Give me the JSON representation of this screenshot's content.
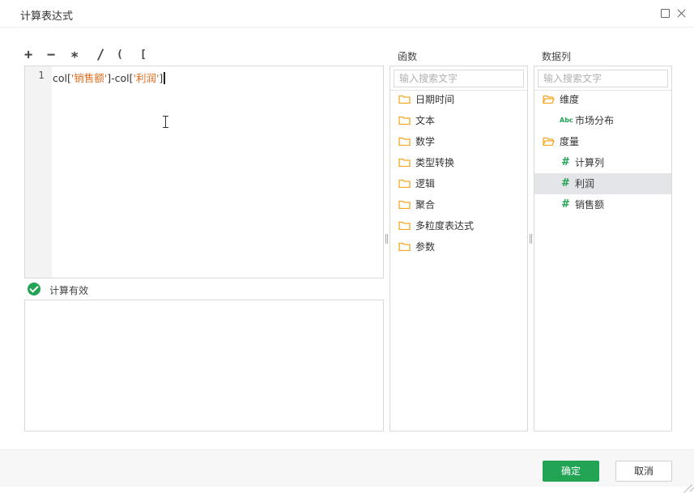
{
  "dialog": {
    "title": "计算表达式",
    "maximize_icon": "maximize-icon",
    "close_icon": "close-icon"
  },
  "operators": [
    "+",
    "−",
    "∗",
    "/",
    "( )",
    "[ ]"
  ],
  "editor": {
    "line_number": "1",
    "code_parts": [
      "col[",
      "'销售额'",
      "]-col[",
      "'利润'",
      "]"
    ]
  },
  "status": {
    "text": "计算有效",
    "icon": "check-circle-icon",
    "color": "#23a455"
  },
  "functions": {
    "header": "函数",
    "search_placeholder": "输入搜索文字",
    "items": [
      "日期时间",
      "文本",
      "数学",
      "类型转换",
      "逻辑",
      "聚合",
      "多粒度表达式",
      "参数"
    ]
  },
  "columns": {
    "header": "数据列",
    "search_placeholder": "输入搜索文字",
    "dimension": {
      "label": "维度",
      "children": [
        {
          "badge": "Abc",
          "label": "市场分布"
        }
      ]
    },
    "measure": {
      "label": "度量",
      "children": [
        {
          "badge": "#",
          "label": "计算列"
        },
        {
          "badge": "#",
          "label": "利润",
          "selected": true
        },
        {
          "badge": "#",
          "label": "销售额"
        }
      ]
    }
  },
  "footer": {
    "ok_label": "确定",
    "cancel_label": "取消"
  },
  "colors": {
    "accent": "#23a455",
    "folder": "#f5a623",
    "string": "#e06c1c",
    "selected_row": "#e4e5e8"
  }
}
